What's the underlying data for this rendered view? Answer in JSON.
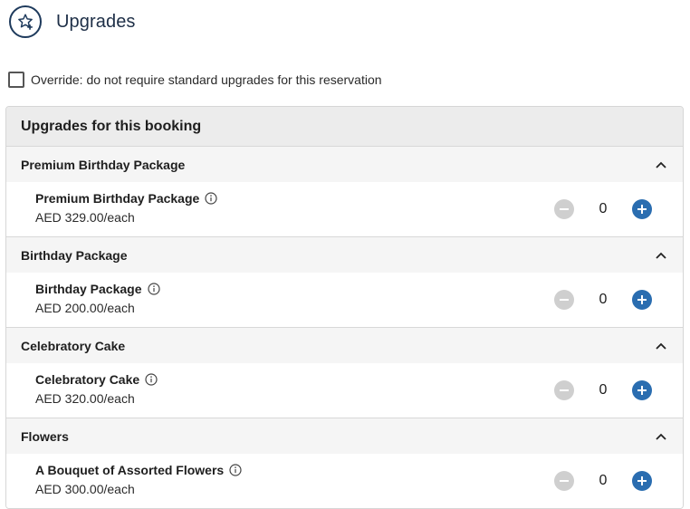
{
  "header": {
    "title": "Upgrades",
    "icon": "star-plus-icon"
  },
  "override": {
    "label": "Override: do not require standard upgrades for this reservation",
    "checked": false
  },
  "panel": {
    "title": "Upgrades for this booking",
    "sections": [
      {
        "title": "Premium Birthday Package",
        "expanded": true,
        "items": [
          {
            "name": "Premium Birthday Package",
            "price": "AED 329.00/each",
            "quantity": "0"
          }
        ]
      },
      {
        "title": "Birthday Package",
        "expanded": true,
        "items": [
          {
            "name": "Birthday Package",
            "price": "AED 200.00/each",
            "quantity": "0"
          }
        ]
      },
      {
        "title": "Celebratory Cake",
        "expanded": true,
        "items": [
          {
            "name": "Celebratory Cake",
            "price": "AED 320.00/each",
            "quantity": "0"
          }
        ]
      },
      {
        "title": "Flowers",
        "expanded": true,
        "items": [
          {
            "name": "A Bouquet of Assorted Flowers",
            "price": "AED 300.00/each",
            "quantity": "0"
          }
        ]
      }
    ]
  },
  "colors": {
    "accent": "#2a6db0",
    "disabled": "#cfcfcf",
    "title": "#1e2f47"
  }
}
